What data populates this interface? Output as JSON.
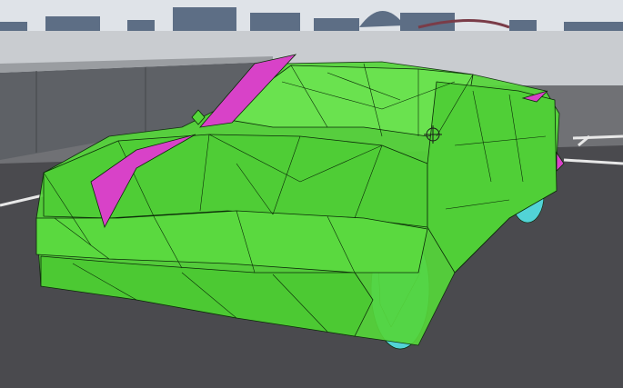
{
  "scene": {
    "view": "3d-viewport",
    "subject": "vehicle-collision-mesh-debug-view",
    "colors": {
      "sky": "#dfe3e8",
      "horizon_buildings": "#5d6e85",
      "ground_far": "#c9ccd0",
      "asphalt": "#4a4a4e",
      "concrete_wall": "#5e6166",
      "lane_marking": "#e8e8e8",
      "body_mesh": "#55d63a",
      "accent_mesh": "#d842c8",
      "wheel_mesh": "#52d3d6",
      "wireframe": "#0b2a08",
      "gizmo": "#1a1a1a"
    },
    "icons": [
      "pivot-crosshair-icon",
      "node-diamond-icon"
    ]
  }
}
